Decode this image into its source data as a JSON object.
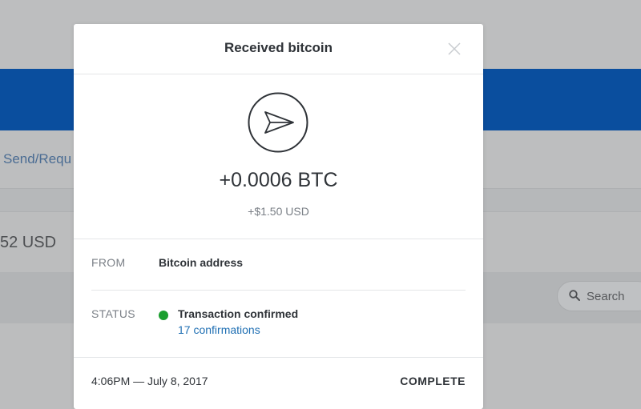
{
  "background": {
    "nav_label": "Send/Requ",
    "balance_text": "52 USD",
    "search_placeholder": "Search"
  },
  "modal": {
    "title": "Received bitcoin",
    "icon": "send-arrow-icon",
    "amount_btc": "+0.0006 BTC",
    "amount_usd": "+$1.50 USD",
    "from_label": "FROM",
    "from_value": "Bitcoin address",
    "status_label": "STATUS",
    "status_value": "Transaction confirmed",
    "status_color": "#1a9e2e",
    "confirmations": "17 confirmations",
    "timestamp": "4:06PM — July 8, 2017",
    "completion": "COMPLETE"
  },
  "colors": {
    "brand_blue": "#0a4e9e",
    "link": "#1f6fb3"
  }
}
